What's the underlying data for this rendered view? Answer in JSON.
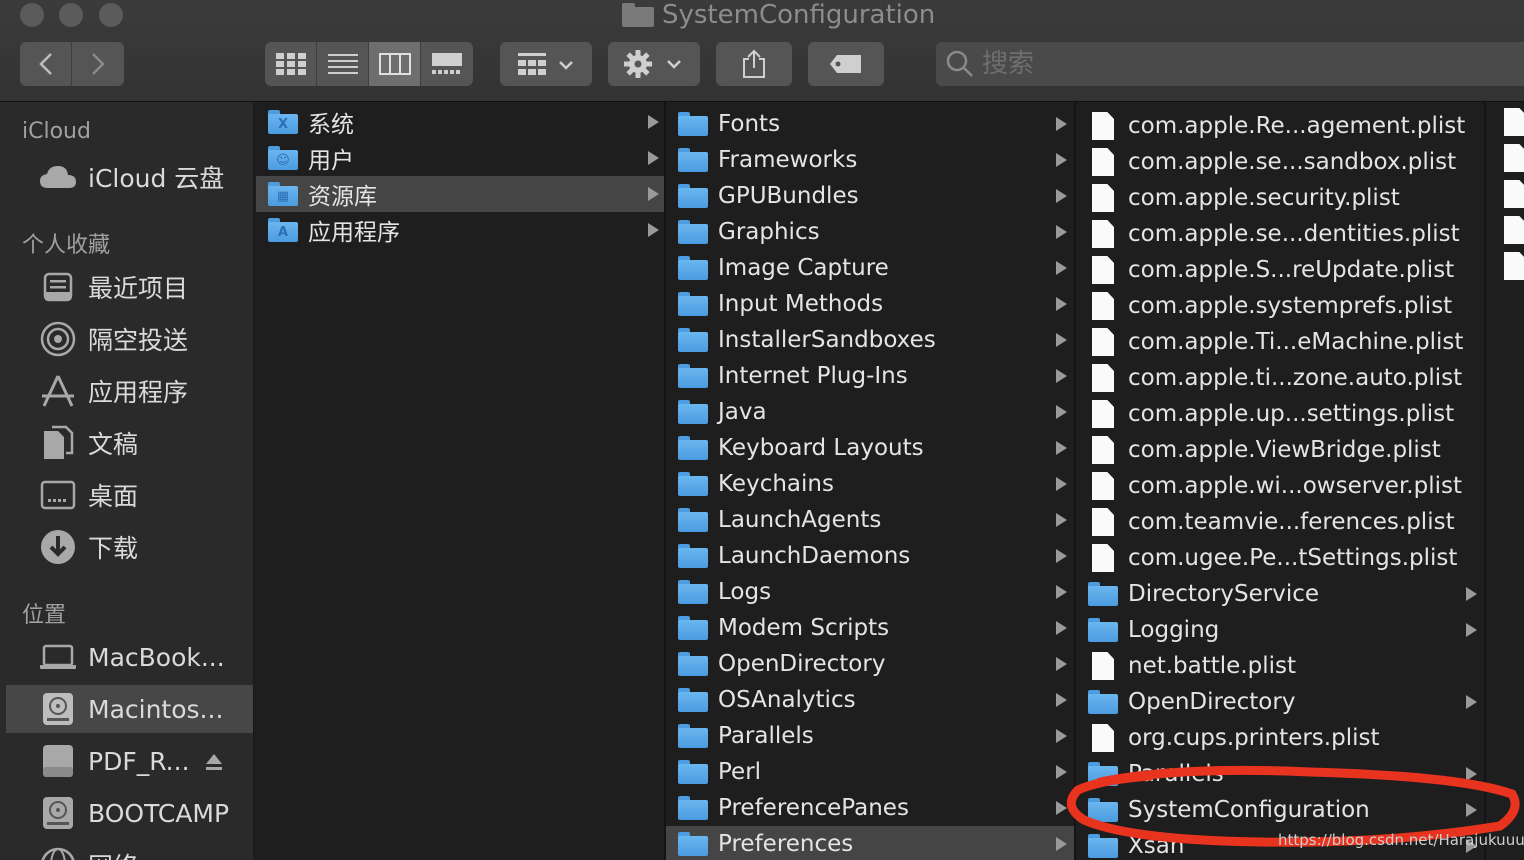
{
  "window": {
    "title": "SystemConfiguration"
  },
  "search": {
    "placeholder": "搜索"
  },
  "sidebar": {
    "sections": [
      {
        "header": "iCloud",
        "items": [
          {
            "label": "iCloud 云盘",
            "icon": "cloud-icon"
          }
        ]
      },
      {
        "header": "个人收藏",
        "items": [
          {
            "label": "最近项目",
            "icon": "recents-icon"
          },
          {
            "label": "隔空投送",
            "icon": "airdrop-icon"
          },
          {
            "label": "应用程序",
            "icon": "applications-icon"
          },
          {
            "label": "文稿",
            "icon": "documents-icon"
          },
          {
            "label": "桌面",
            "icon": "desktop-icon"
          },
          {
            "label": "下载",
            "icon": "downloads-icon"
          }
        ]
      },
      {
        "header": "位置",
        "items": [
          {
            "label": "MacBook...",
            "icon": "laptop-icon"
          },
          {
            "label": "Macintos...",
            "icon": "disk-icon",
            "selected": true
          },
          {
            "label": "PDF_R...",
            "icon": "external-disk-icon",
            "eject": true
          },
          {
            "label": "BOOTCAMP",
            "icon": "disk-icon"
          },
          {
            "label": "网络",
            "icon": "network-icon"
          }
        ]
      }
    ]
  },
  "column1": [
    {
      "label": "系统",
      "glyph": "X"
    },
    {
      "label": "用户",
      "glyph": "☺"
    },
    {
      "label": "资源库",
      "glyph": "▦",
      "selected": true
    },
    {
      "label": "应用程序",
      "glyph": "A"
    }
  ],
  "column2": [
    "Fonts",
    "Frameworks",
    "GPUBundles",
    "Graphics",
    "Image Capture",
    "Input Methods",
    "InstallerSandboxes",
    "Internet Plug-Ins",
    "Java",
    "Keyboard Layouts",
    "Keychains",
    "LaunchAgents",
    "LaunchDaemons",
    "Logs",
    "Modem Scripts",
    "OpenDirectory",
    "OSAnalytics",
    "Parallels",
    "Perl",
    "PreferencePanes",
    "Preferences"
  ],
  "column2_selected": "Preferences",
  "column3": [
    {
      "label": "com.apple.Re...agement.plist",
      "kind": "file"
    },
    {
      "label": "com.apple.se...sandbox.plist",
      "kind": "file"
    },
    {
      "label": "com.apple.security.plist",
      "kind": "file"
    },
    {
      "label": "com.apple.se...dentities.plist",
      "kind": "file"
    },
    {
      "label": "com.apple.S...reUpdate.plist",
      "kind": "file"
    },
    {
      "label": "com.apple.systemprefs.plist",
      "kind": "file"
    },
    {
      "label": "com.apple.Ti...eMachine.plist",
      "kind": "file"
    },
    {
      "label": "com.apple.ti...zone.auto.plist",
      "kind": "file"
    },
    {
      "label": "com.apple.up...settings.plist",
      "kind": "file"
    },
    {
      "label": "com.apple.ViewBridge.plist",
      "kind": "file"
    },
    {
      "label": "com.apple.wi...owserver.plist",
      "kind": "file"
    },
    {
      "label": "com.teamvie...ferences.plist",
      "kind": "file"
    },
    {
      "label": "com.ugee.Pe...tSettings.plist",
      "kind": "file"
    },
    {
      "label": "DirectoryService",
      "kind": "folder"
    },
    {
      "label": "Logging",
      "kind": "folder"
    },
    {
      "label": "net.battle.plist",
      "kind": "file"
    },
    {
      "label": "OpenDirectory",
      "kind": "folder"
    },
    {
      "label": "org.cups.printers.plist",
      "kind": "file"
    },
    {
      "label": "Parallels",
      "kind": "folder"
    },
    {
      "label": "SystemConfiguration",
      "kind": "folder"
    },
    {
      "label": "Xsan",
      "kind": "folder"
    }
  ],
  "annotation": {
    "highlighted_item": "SystemConfiguration",
    "color": "#e8331f"
  },
  "watermark": "https://blog.csdn.net/Harajukuuuu",
  "colors": {
    "folder": "#5aa8e8",
    "selected_row": "#454545",
    "sidebar_selected": "#474747"
  }
}
